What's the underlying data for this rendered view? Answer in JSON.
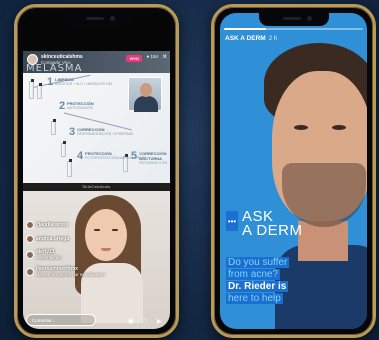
{
  "left_phone": {
    "live": {
      "username": "skinceuticalshms",
      "subtitle": "Compartir Vivo",
      "badge": "VIVO",
      "viewers": "● 154",
      "close_glyph": "×"
    },
    "slide": {
      "title": "MELASMA",
      "steps": [
        {
          "num": "1",
          "title": "LIMPIEZA",
          "desc": "BOOSTER + ALC / LIMPIADOR GEL"
        },
        {
          "num": "2",
          "title": "PROTECCIÓN",
          "desc": "ANTIOXIDANTE"
        },
        {
          "num": "3",
          "title": "CORRECCIÓN",
          "desc": "DESPIGMENTACIÓN / EPIDERMIS"
        },
        {
          "num": "4",
          "title": "PROTECCIÓN",
          "desc": "FOTOPROTECCIÓN AMPLIA / FPS 50"
        },
        {
          "num": "5",
          "title": "CORRECCIÓN NOCTURNA",
          "desc": "RETINOIDE 0.3%"
        }
      ],
      "brand_footer": "SkinCeuticals"
    },
    "comments": [
      {
        "user": "claudiaramos",
        "msg": ""
      },
      {
        "user": "andrea.ortega",
        "msg": ""
      },
      {
        "user": "aletty21",
        "msg": "Alimentación"
      },
      {
        "user": "lisorsummerfitmx",
        "msg": "Hacen descuento por estudiantes?"
      }
    ],
    "comment_placeholder": "Comentar...",
    "icons": {
      "camera": "camera-icon",
      "heart": "heart-icon",
      "share": "share-icon"
    }
  },
  "right_phone": {
    "story": {
      "handle": "ASK A DERM",
      "time": "2 h",
      "progress": 0.3,
      "dots": "•••",
      "title_line1": "ASK",
      "title_line2": "A DERM",
      "caption_lines": [
        {
          "text": "Do you suffer",
          "style": "accent"
        },
        {
          "text": "from acne?",
          "style": "accent"
        },
        {
          "text": "Dr. Rieder is",
          "style": "bold"
        },
        {
          "text": "here to help",
          "style": "accent"
        }
      ]
    }
  },
  "colors": {
    "background": "#152a47",
    "phone_frame": "#b89a5a",
    "story_blue": "#2f8fd7",
    "live_badge": "#e83a7a"
  }
}
